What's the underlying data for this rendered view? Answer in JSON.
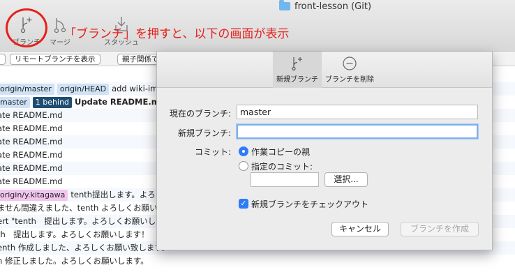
{
  "window": {
    "title": "front-lesson (Git)"
  },
  "toolbar": {
    "branch_label": "ブランチ",
    "merge_label": "マージ",
    "stash_label": "スタッシュ"
  },
  "annotation": {
    "text": "「ブランチ」を押すと、以下の画面が表示"
  },
  "filterbar": {
    "remote_branch_select": "リモートブランチを表示",
    "parent_order_select": "親子関係で"
  },
  "commits": [
    {
      "tags": [
        {
          "text": "origin/master",
          "style": "blue"
        },
        {
          "text": "origin/HEAD",
          "style": "blue",
          "icon": "branch-icon"
        }
      ],
      "message": "add wiki-imag",
      "bold": false
    },
    {
      "tags": [
        {
          "text": "master",
          "style": "blue"
        },
        {
          "text": "1 behind",
          "style": "dark"
        }
      ],
      "message": "Update README.md",
      "bold": true
    },
    {
      "tags": [],
      "message": "ate README.md",
      "bold": false
    },
    {
      "tags": [],
      "message": "ate README.md",
      "bold": false
    },
    {
      "tags": [],
      "message": "ate README.md",
      "bold": false
    },
    {
      "tags": [],
      "message": "ate README.md",
      "bold": false
    },
    {
      "tags": [],
      "message": "ate README.md",
      "bold": false
    },
    {
      "tags": [],
      "message": "ate README.md",
      "bold": false
    },
    {
      "tags": [
        {
          "text": "origin/y.kitagawa",
          "style": "pink"
        }
      ],
      "message": "tenth提出します。よろしくお",
      "bold": false
    },
    {
      "tags": [],
      "message": "ません間違えました、tenth よろしくお願いします",
      "bold": false
    },
    {
      "tags": [],
      "message": "ert \"tenth　提出します。よろしくお願いします",
      "bold": false
    },
    {
      "tags": [],
      "message": "th　提出します。よろしくお願いします！",
      "bold": false
    },
    {
      "tags": [],
      "message": "enth 作成しました、よろしくお願い致します。",
      "bold": false
    },
    {
      "tags": [],
      "message": "n 修正しました。よろしくお願いします。",
      "bold": false
    }
  ],
  "dialog": {
    "tab_new": "新規ブランチ",
    "tab_delete": "ブランチを削除",
    "current_branch_label": "現在のブランチ:",
    "current_branch_value": "master",
    "new_branch_label": "新規ブランチ:",
    "new_branch_value": "",
    "commit_label": "コミット:",
    "option_working_copy": "作業コピーの親",
    "option_specified_commit": "指定のコミット:",
    "select_button": "選択...",
    "checkout_label": "新規ブランチをチェックアウト",
    "cancel_button": "キャンセル",
    "create_button": "ブランチを作成",
    "accent_color": "#2e7cf6"
  }
}
